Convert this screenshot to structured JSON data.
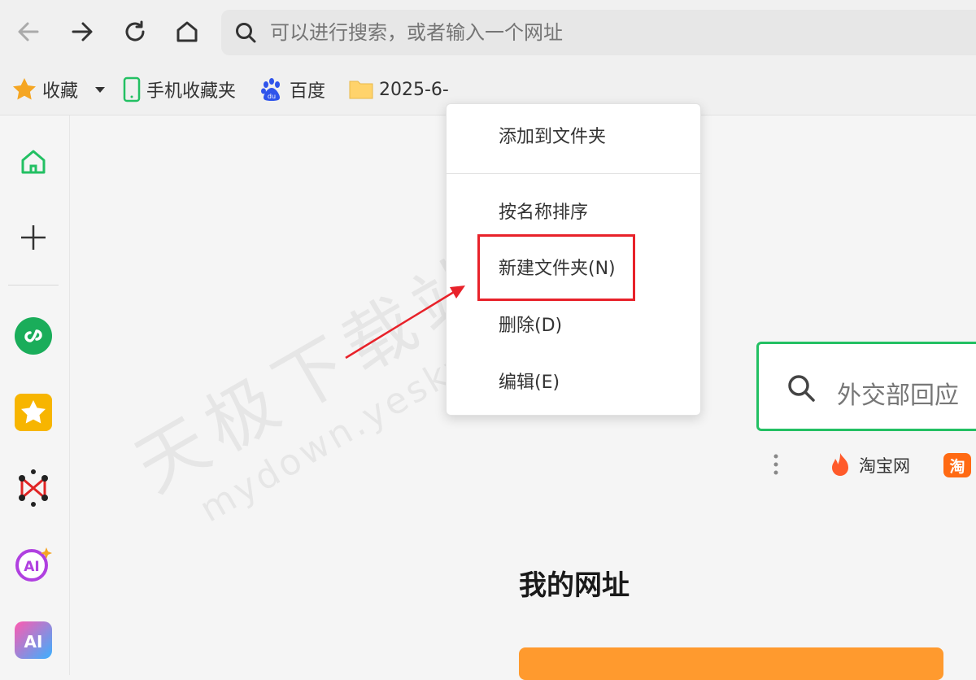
{
  "address_bar": {
    "placeholder": "可以进行搜索，或者输入一个网址"
  },
  "bookmarks": [
    {
      "label": "收藏",
      "icon": "star-icon"
    },
    {
      "label": "手机收藏夹",
      "icon": "phone-icon"
    },
    {
      "label": "百度",
      "icon": "baidu-paw-icon"
    },
    {
      "label": "2025-6-",
      "icon": "folder-icon"
    }
  ],
  "context_menu": {
    "items": [
      {
        "label": "添加到文件夹"
      },
      {
        "label": "按名称排序"
      },
      {
        "label": "新建文件夹(N)"
      },
      {
        "label": "删除(D)"
      },
      {
        "label": "编辑(E)"
      }
    ]
  },
  "search": {
    "text": "外交部回应"
  },
  "quick_links": [
    {
      "label": "淘宝网",
      "icon": "fire-icon"
    },
    {
      "label": "淘",
      "icon": "taobao-icon"
    }
  ],
  "section": {
    "title": "我的网址"
  },
  "watermark": {
    "line1": "天极下载站",
    "line2": "mydown.yesky.com"
  },
  "colors": {
    "accent_green": "#23c063",
    "highlight_red": "#e8222a",
    "orange": "#ff9a2e"
  }
}
